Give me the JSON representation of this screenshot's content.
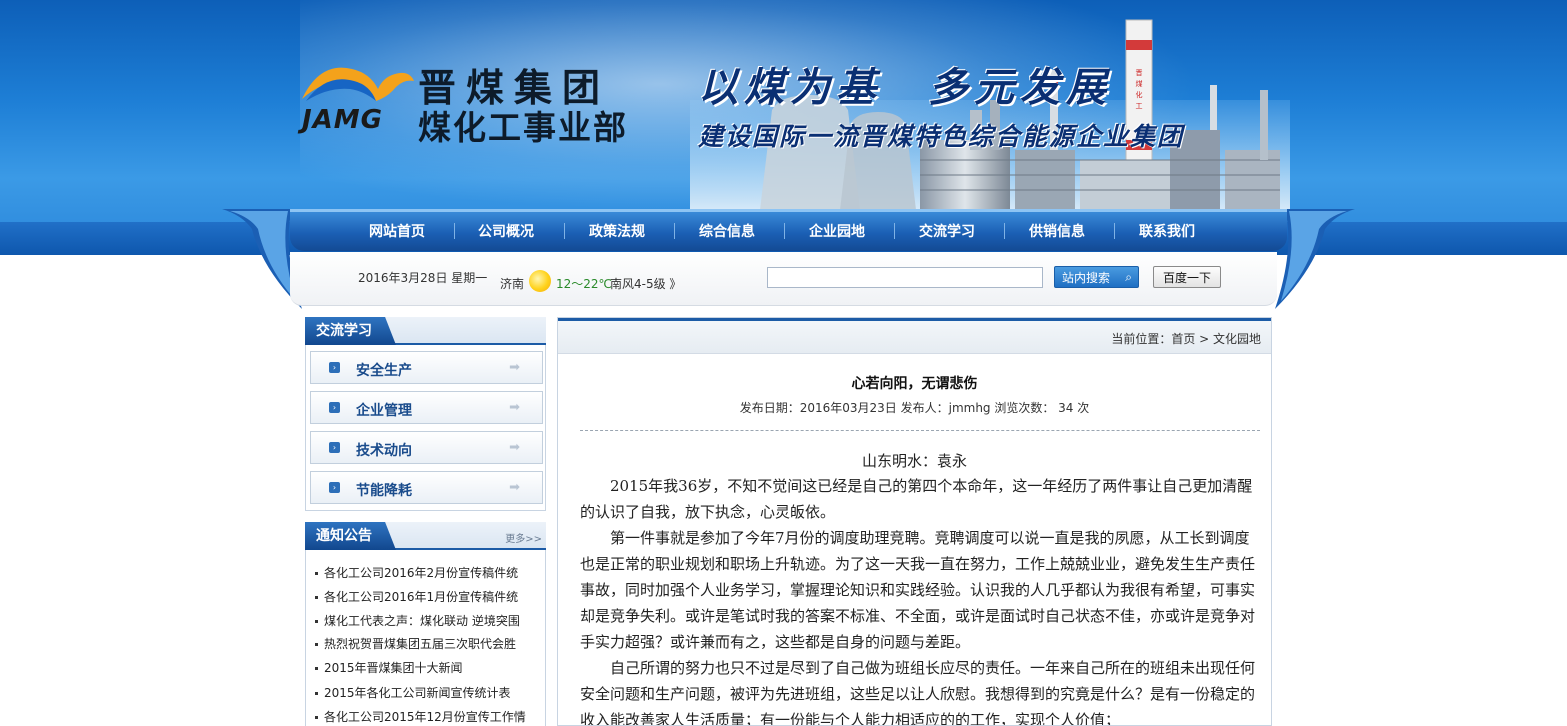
{
  "header": {
    "logo_cn_line1": "晋煤集团",
    "logo_cn_line2": "煤化工事业部",
    "logo_en": "JAMG",
    "slogan_line1": "以煤为基　多元发展",
    "slogan_line2": "建设国际一流晋煤特色综合能源企业集团",
    "tower_text": "晋煤化工"
  },
  "nav": {
    "items": [
      "网站首页",
      "公司概况",
      "政策法规",
      "综合信息",
      "企业园地",
      "交流学习",
      "供销信息",
      "联系我们"
    ]
  },
  "infobar": {
    "date": "2016年3月28日  星期一",
    "city": "济南",
    "temperature": "12～22℃",
    "wind": "南风4-5级 》",
    "search_placeholder": "",
    "site_search_label": "站内搜索",
    "baidu_label": "百度一下"
  },
  "sidebar": {
    "study_title": "交流学习",
    "study_items": [
      "安全生产",
      "企业管理",
      "技术动向",
      "节能降耗"
    ],
    "notice_title": "通知公告",
    "notice_more": "更多>>",
    "notices": [
      "各化工公司2016年2月份宣传稿件统",
      "各化工公司2016年1月份宣传稿件统",
      "煤化工代表之声：煤化联动 逆境突围",
      "热烈祝贺晋煤集团五届三次职代会胜",
      "2015年晋煤集团十大新闻",
      "2015年各化工公司新闻宣传统计表",
      "各化工公司2015年12月份宣传工作情"
    ]
  },
  "article": {
    "breadcrumb": "当前位置：首页 > 文化园地",
    "title": "心若向阳，无谓悲伤",
    "meta": "发布日期：2016年03月23日   发布人：jmmhg   浏览次数：   34   次",
    "byline": "山东明水：袁永",
    "paragraphs": [
      "2015年我36岁，不知不觉间这已经是自己的第四个本命年，这一年经历了两件事让自己更加清醒的认识了自我，放下执念，心灵皈依。",
      "第一件事就是参加了今年7月份的调度助理竞聘。竞聘调度可以说一直是我的夙愿，从工长到调度也是正常的职业规划和职场上升轨迹。为了这一天我一直在努力，工作上兢兢业业，避免发生生产责任事故，同时加强个人业务学习，掌握理论知识和实践经验。认识我的人几乎都认为我很有希望，可事实却是竞争失利。或许是笔试时我的答案不标准、不全面，或许是面试时自己状态不佳，亦或许是竞争对手实力超强？或许兼而有之，这些都是自身的问题与差距。",
      "自己所谓的努力也只不过是尽到了自己做为班组长应尽的责任。一年来自己所在的班组未出现任何安全问题和生产问题，被评为先进班组，这些足以让人欣慰。我想得到的究竟是什么？是有一份稳定的收入能改善家人生活质量；有一份能与个人能力相适应的的工作，实现个人价值；"
    ]
  }
}
